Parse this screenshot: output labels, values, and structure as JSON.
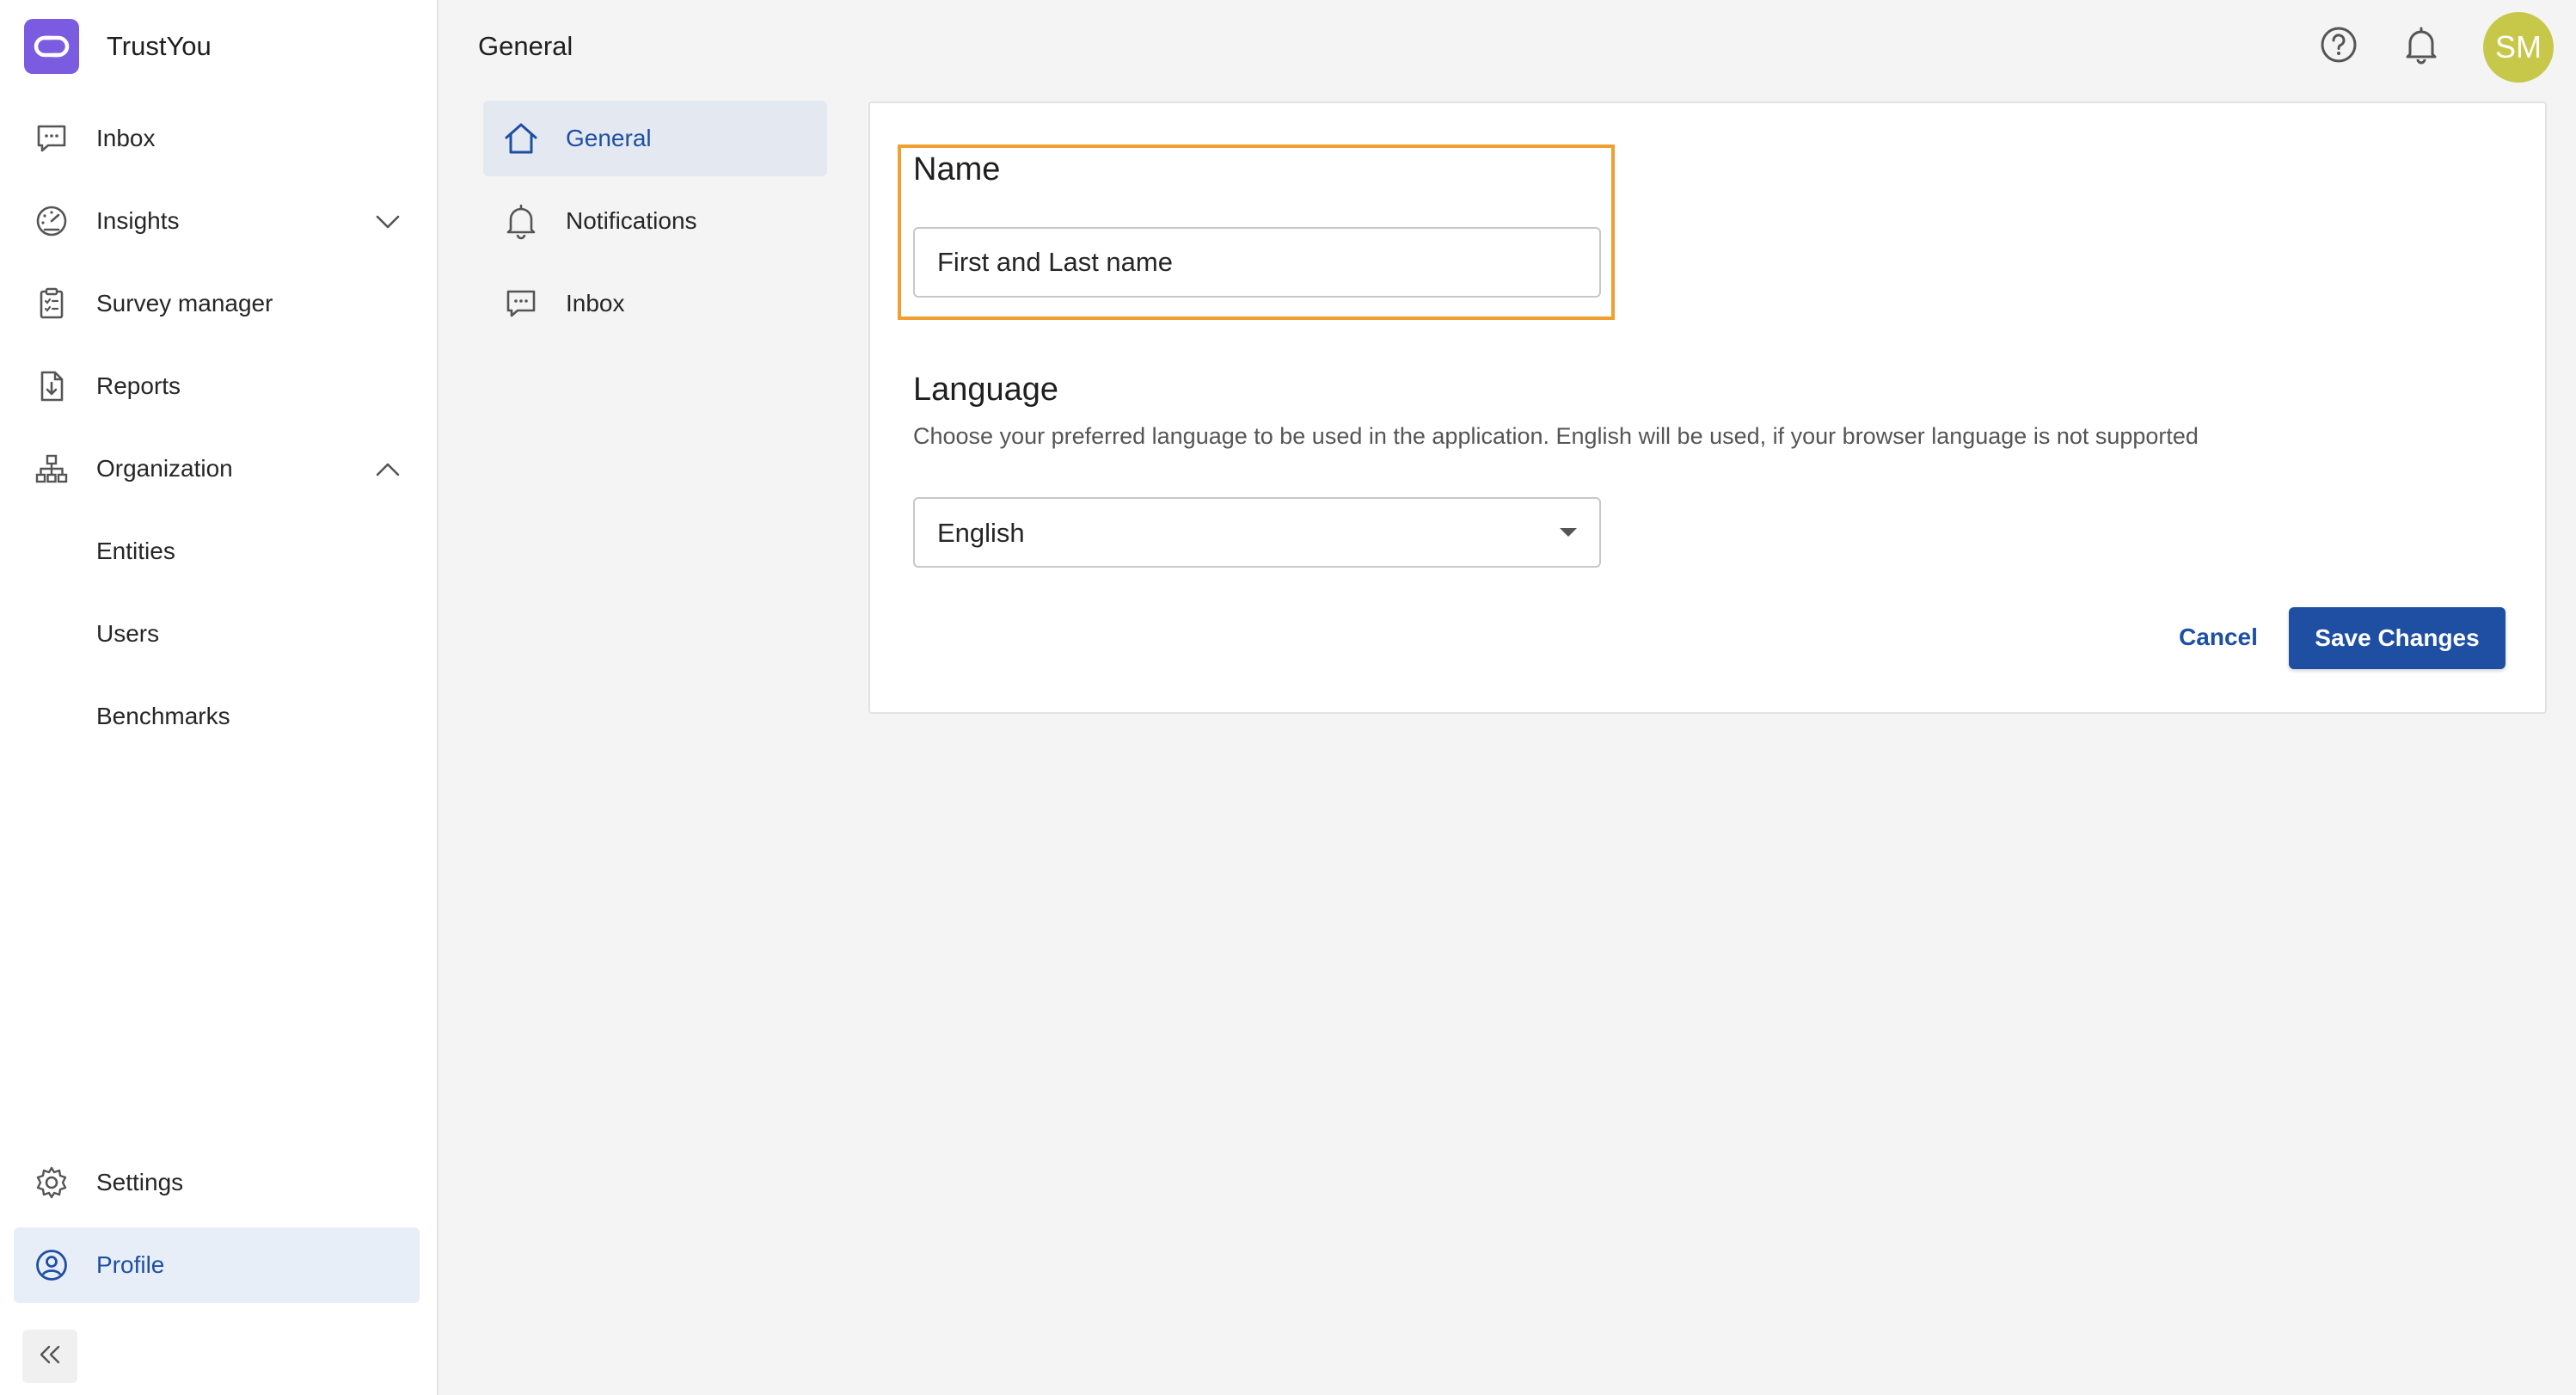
{
  "app": {
    "name": "TrustYou",
    "brand_color": "#7b5ce0"
  },
  "sidebar": {
    "items": [
      {
        "label": "Inbox",
        "icon": "chat-bubble-icon"
      },
      {
        "label": "Insights",
        "icon": "gauge-icon",
        "chevron": "down"
      },
      {
        "label": "Survey manager",
        "icon": "clipboard-icon"
      },
      {
        "label": "Reports",
        "icon": "file-download-icon"
      },
      {
        "label": "Organization",
        "icon": "org-chart-icon",
        "chevron": "up"
      },
      {
        "label": "Entities"
      },
      {
        "label": "Users"
      },
      {
        "label": "Benchmarks"
      }
    ],
    "bottom_items": [
      {
        "label": "Settings",
        "icon": "gear-icon"
      },
      {
        "label": "Profile",
        "icon": "user-circle-icon",
        "active": true
      }
    ],
    "collapse_icon": "double-chevron-left-icon"
  },
  "header": {
    "title": "General",
    "help_icon": "help-circle-icon",
    "bell_icon": "bell-icon",
    "avatar_initials": "SM",
    "avatar_color": "#c7c84a"
  },
  "sub_nav": {
    "items": [
      {
        "label": "General",
        "icon": "home-icon",
        "active": true
      },
      {
        "label": "Notifications",
        "icon": "bell-icon"
      },
      {
        "label": "Inbox",
        "icon": "chat-bubble-icon"
      }
    ]
  },
  "form": {
    "name": {
      "title": "Name",
      "placeholder": "First and Last name",
      "value": ""
    },
    "language": {
      "title": "Language",
      "description": "Choose your preferred language to be used in the application. English will be used, if your browser language is not supported",
      "selected": "English"
    },
    "cancel_label": "Cancel",
    "save_label": "Save Changes",
    "accent_color": "#1f4fa3",
    "highlight_color": "#f0a030"
  }
}
